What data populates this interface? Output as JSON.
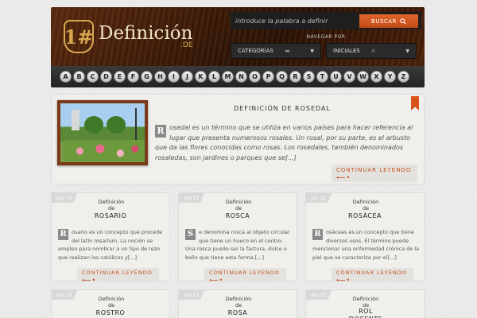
{
  "header": {
    "logo_mark": "1#",
    "logo_text": "Definición",
    "logo_sub": ".DE",
    "search_placeholder": "introduce la palabra a definir",
    "search_button": "BUSCAR",
    "nav_title": "NAVEGAR POR",
    "select_categories": "CATEGORÍAS",
    "select_initials": "INICIALES",
    "select_initials_value": "A"
  },
  "alphabet": [
    "A",
    "B",
    "C",
    "D",
    "E",
    "F",
    "G",
    "H",
    "I",
    "J",
    "K",
    "L",
    "M",
    "N",
    "O",
    "P",
    "Q",
    "R",
    "S",
    "T",
    "U",
    "V",
    "W",
    "X",
    "Y",
    "Z"
  ],
  "featured": {
    "title": "DEFINICIÓN DE ROSEDAL",
    "dropcap": "R",
    "text": "osedal es un término que se utiliza en varios países para hacer referencia al lugar que presenta numerosos rosales. Un rosal, por su parte, es el arbusto que da las flores conocidas como rosas. Los rosedales, también denominados rosaledas, son jardines o parques que se[...]",
    "continue": "CONTINUAR LEYENDO"
  },
  "cards": [
    {
      "date": "jun 18",
      "def": "Definición de",
      "title": "ROSARIO",
      "dropcap": "R",
      "text": "osario es un concepto que procede del latín rosarĭum. La noción se emplea para nombrar a un tipo de rezo que realizan los católicos y[...]",
      "continue": "CONTINUAR LEYENDO"
    },
    {
      "date": "jun 15",
      "def": "Definición de",
      "title": "ROSCA",
      "dropcap": "S",
      "text": "e denomina rosca al objeto circular que tiene un hueco en el centro. Una rosca puede ser la factura, dulce o bollo que tiene esta forma.[...]",
      "continue": "CONTINUAR LEYENDO"
    },
    {
      "date": "jun 12",
      "def": "Definición de",
      "title": "ROSÁCEA",
      "dropcap": "R",
      "text": "osáceas es un concepto que tiene diversos usos. El término puede mencionar una enfermedad crónica de la piel que se caracteriza por el[...]",
      "continue": "CONTINUAR LEYENDO"
    },
    {
      "date": "jun 13",
      "def": "Definición de",
      "title": "ROSTRO"
    },
    {
      "date": "jun 13",
      "def": "Definición de",
      "title": "ROSA"
    },
    {
      "date": "jun 12",
      "def": "Definición de",
      "title": "ROL DOCENTE"
    }
  ]
}
